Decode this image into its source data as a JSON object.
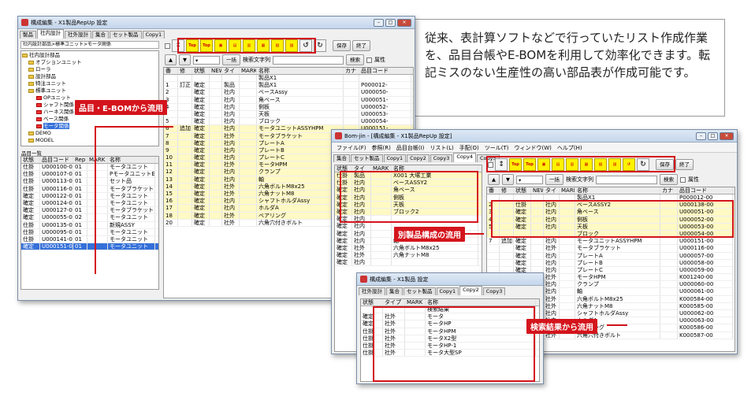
{
  "description": "従来、表計算ソフトなどで行っていたリスト作成作業を、品目台帳やE-BOMを利用して効率化できます。転記ミスのない生産性の高い部品表が作成可能です。",
  "callouts": {
    "c1": "品目・E-BOMから流用",
    "c2": "別製品構成の流用",
    "c3": "検索結果から流用"
  },
  "win1": {
    "title": "構成編集 - X1製品RepUp 設定",
    "tabs": [
      "製品",
      "社内設計",
      "社外設計",
      "集合",
      "セット製品",
      "Copy1"
    ],
    "path": "社内設計部品>標準ユニット>モータ関係",
    "search_label": "検索文字列",
    "search_btn": "検索",
    "attr_label": "属性",
    "save": "保存",
    "end": "終了",
    "ichiran": "一括",
    "tree": [
      "社内設計部品",
      "オプションユニット",
      "ローラ",
      "設計部品",
      "特注ユニット",
      "標準ユニット",
      "OPユニット",
      "シャフト関係",
      "ハーネス関係",
      "ベース関係",
      "モータ関係",
      "DEMO",
      "MODEL"
    ],
    "list_title": "品目一覧",
    "list_headers": [
      "状態",
      "品目コード",
      "Rep",
      "MARK",
      "名称"
    ],
    "list_rows": [
      [
        "仕掛",
        "U000100-00",
        "01",
        "",
        "モータユニット"
      ],
      [
        "仕掛",
        "U000107-00",
        "01",
        "",
        "PモータユニットE"
      ],
      [
        "仕掛",
        "U000113-00",
        "01",
        "",
        "セット品"
      ],
      [
        "仕掛",
        "U000116-00",
        "01",
        "",
        "モータブラケット"
      ],
      [
        "確定",
        "U000122-00",
        "01",
        "",
        "モータユニット"
      ],
      [
        "確定",
        "U000124-00",
        "01",
        "",
        "モータユニット"
      ],
      [
        "確定",
        "U000127-00",
        "01",
        "",
        "モータブラケット"
      ],
      [
        "確定",
        "U000055-00",
        "02",
        "",
        "モータユニット"
      ],
      [
        "仕掛",
        "U000135-00",
        "01",
        "",
        "新規ASSY"
      ],
      [
        "仕掛",
        "U000095-00",
        "01",
        "",
        "モータユニット"
      ],
      [
        "仕掛",
        "U000141-00",
        "01",
        "",
        "モータユニット"
      ],
      [
        "確定",
        "U000151-00",
        "01",
        "",
        "モータユニット"
      ]
    ],
    "grid_headers": [
      "番号",
      "修正",
      "状態",
      "NEW",
      "タイプ",
      "MARK",
      "名称",
      "カナ",
      "品目コード"
    ],
    "grid_rows": [
      [
        "",
        "",
        "",
        "",
        "",
        "",
        "製品X1",
        "",
        ""
      ],
      [
        "1",
        "訂正",
        "確定",
        "",
        "製品",
        "",
        "製品X1",
        "",
        "P000012-"
      ],
      [
        "2",
        "",
        "確定",
        "",
        "社内",
        "",
        "ベースAssy",
        "",
        "U000050-"
      ],
      [
        "3",
        "",
        "確定",
        "",
        "社内",
        "",
        "角ベース",
        "",
        "U000051-"
      ],
      [
        "4",
        "",
        "確定",
        "",
        "社内",
        "",
        "側板",
        "",
        "U000052-"
      ],
      [
        "",
        "",
        "確定",
        "",
        "社内",
        "",
        "天板",
        "",
        "U000053-"
      ],
      [
        "5",
        "",
        "確定",
        "",
        "社内",
        "",
        "ブロック",
        "",
        "U000054-"
      ],
      [
        "6",
        "追加",
        "確定",
        "",
        "社内",
        "",
        "モータユニットASSYHPM",
        "",
        "U000151-"
      ],
      [
        "7",
        "",
        "確定",
        "",
        "社外",
        "",
        "モータブラケット",
        "",
        "U000116-"
      ],
      [
        "8",
        "",
        "確定",
        "",
        "社内",
        "",
        "プレートA",
        "",
        "U000057-"
      ],
      [
        "9",
        "",
        "確定",
        "",
        "社内",
        "",
        "プレートB",
        "",
        "U000058-"
      ],
      [
        "10",
        "",
        "確定",
        "",
        "社内",
        "",
        "プレートC",
        "",
        "U000059-"
      ],
      [
        "11",
        "",
        "確定",
        "",
        "社外",
        "",
        "モータHPM",
        "",
        "K001240-"
      ],
      [
        "12",
        "",
        "確定",
        "",
        "社内",
        "",
        "クランプ",
        "",
        "U000060-"
      ],
      [
        "13",
        "",
        "確定",
        "",
        "社内",
        "",
        "軸",
        "",
        "U000061-"
      ],
      [
        "14",
        "",
        "確定",
        "",
        "社外",
        "",
        "六角ボルトM8x25",
        "",
        "K000584-"
      ],
      [
        "15",
        "",
        "確定",
        "",
        "社外",
        "",
        "六角ナットM8",
        "",
        "K000585-"
      ],
      [
        "16",
        "",
        "確定",
        "",
        "社内",
        "",
        "シャフトホルダAssy",
        "",
        "U000062-"
      ],
      [
        "17",
        "",
        "確定",
        "",
        "社内",
        "",
        "ホルダA",
        "",
        "U000063-"
      ],
      [
        "18",
        "",
        "確定",
        "",
        "社外",
        "",
        "ベアリング",
        "",
        "K000586-"
      ],
      [
        "20",
        "",
        "確定",
        "",
        "社外",
        "",
        "六角穴付きボルト",
        "",
        "K000587-"
      ]
    ]
  },
  "win2": {
    "title": "Bom-jin - [構成編集 - X1製品RepUp 設定]",
    "menus": [
      "ファイル(F)",
      "参照(R)",
      "品目台帳(I)",
      "リスト(L)",
      "手配(O)",
      "ツール(T)",
      "ウィンドウ(W)",
      "ヘルプ(H)"
    ],
    "tabs": [
      "集合",
      "セット製品",
      "Copy1",
      "Copy2",
      "Copy3",
      "Copy4",
      "Copy5"
    ],
    "search_label": "検索文字列",
    "search_btn": "検索",
    "attr_label": "属性",
    "save": "保存",
    "end": "終了",
    "ichiran": "一括",
    "left_headers": [
      "状態",
      "タイプ",
      "MARK",
      "名称"
    ],
    "left_rows": [
      [
        "仕掛",
        "製品",
        "",
        "X001 大塚工業"
      ],
      [
        "仕掛",
        "社内",
        "",
        "ベースASSY2"
      ],
      [
        "確定",
        "社内",
        "",
        "角ベース"
      ],
      [
        "確定",
        "社内",
        "",
        "側板"
      ],
      [
        "確定",
        "社内",
        "",
        "天板"
      ],
      [
        "確定",
        "社内",
        "",
        "ブロック2"
      ],
      [
        "確定",
        "社内",
        "",
        ""
      ],
      [
        "確定",
        "社内",
        "",
        ""
      ],
      [
        "確定",
        "社内",
        "",
        "クランプ"
      ],
      [
        "確定",
        "社内",
        "",
        "軸"
      ],
      [
        "確定",
        "社外",
        "",
        "六角ボルトM8x25"
      ],
      [
        "確定",
        "社外",
        "",
        "六角ナットM8"
      ],
      [
        "確定",
        "社内",
        "",
        ""
      ]
    ],
    "grid_headers": [
      "番号",
      "修正",
      "状態",
      "NEW",
      "タイプ",
      "MARK",
      "名称",
      "カナ",
      "品目コード"
    ],
    "grid_rows": [
      [
        "",
        "",
        "",
        "",
        "",
        "",
        "製品X1",
        "",
        "P000012-00"
      ],
      [
        "2",
        "",
        "仕掛",
        "",
        "社内",
        "",
        "ベースASSY2",
        "",
        "U000138-00"
      ],
      [
        "3",
        "",
        "確定",
        "",
        "社内",
        "",
        "角ベース",
        "",
        "U000051-00"
      ],
      [
        "4",
        "",
        "確定",
        "",
        "社内",
        "",
        "側板",
        "",
        "U000052-00"
      ],
      [
        "5",
        "",
        "確定",
        "",
        "社内",
        "",
        "天板",
        "",
        "U000053-00"
      ],
      [
        "",
        "",
        "",
        "",
        "",
        "",
        "ブロック",
        "",
        "U000054-00"
      ],
      [
        "7",
        "追加",
        "確定",
        "",
        "社内",
        "",
        "モータユニットASSYHPM",
        "",
        "U000151-00"
      ],
      [
        "",
        "",
        "確定",
        "",
        "社外",
        "",
        "モータブラケット",
        "",
        "U000116-00"
      ],
      [
        "",
        "",
        "確定",
        "",
        "社内",
        "",
        "プレートA",
        "",
        "U000057-00"
      ],
      [
        "",
        "",
        "確定",
        "",
        "社内",
        "",
        "プレートB",
        "",
        "U000058-00"
      ],
      [
        "",
        "",
        "確定",
        "",
        "社内",
        "",
        "プレートC",
        "",
        "U000059-00"
      ],
      [
        "",
        "",
        "確定",
        "",
        "社外",
        "",
        "モータHPM",
        "",
        "K001240-00"
      ],
      [
        "",
        "",
        "確定",
        "",
        "社内",
        "",
        "クランプ",
        "",
        "U000060-00"
      ],
      [
        "",
        "",
        "確定",
        "",
        "社内",
        "",
        "軸",
        "",
        "U000061-00"
      ],
      [
        "",
        "",
        "確定",
        "",
        "社外",
        "",
        "六角ボルトM8x25",
        "",
        "K000584-00"
      ],
      [
        "",
        "",
        "確定",
        "",
        "社外",
        "",
        "六角ナットM8",
        "",
        "K000585-00"
      ],
      [
        "",
        "",
        "確定",
        "",
        "社内",
        "",
        "シャフトホルダAssy",
        "",
        "U000062-00"
      ],
      [
        "",
        "",
        "確定",
        "",
        "社内",
        "",
        "ホルダA",
        "",
        "U000063-00"
      ],
      [
        "",
        "",
        "確定",
        "",
        "社外",
        "",
        "ベアリング",
        "",
        "K000586-00"
      ],
      [
        "",
        "",
        "確定",
        "",
        "社外",
        "",
        "六角穴付きボルト",
        "",
        "K000587-00"
      ]
    ]
  },
  "win3": {
    "title": "構成編集 - X1製品 設定",
    "tabs": [
      "社外設計",
      "集合",
      "セット製品",
      "Copy1",
      "Copy2",
      "Copy3"
    ],
    "headers": [
      "状態",
      "タイプ",
      "MARK",
      "名称"
    ],
    "rows": [
      [
        "",
        "",
        "",
        "検索結果"
      ],
      [
        "確定",
        "社外",
        "",
        "モータ"
      ],
      [
        "確定",
        "社外",
        "",
        "モータHP"
      ],
      [
        "仕掛",
        "社外",
        "",
        "モータHPM"
      ],
      [
        "仕掛",
        "社外",
        "",
        "モータX2型"
      ],
      [
        "仕掛",
        "社外",
        "",
        "モータHP-1"
      ],
      [
        "仕掛",
        "社外",
        "",
        "モータ大型SP"
      ]
    ]
  }
}
